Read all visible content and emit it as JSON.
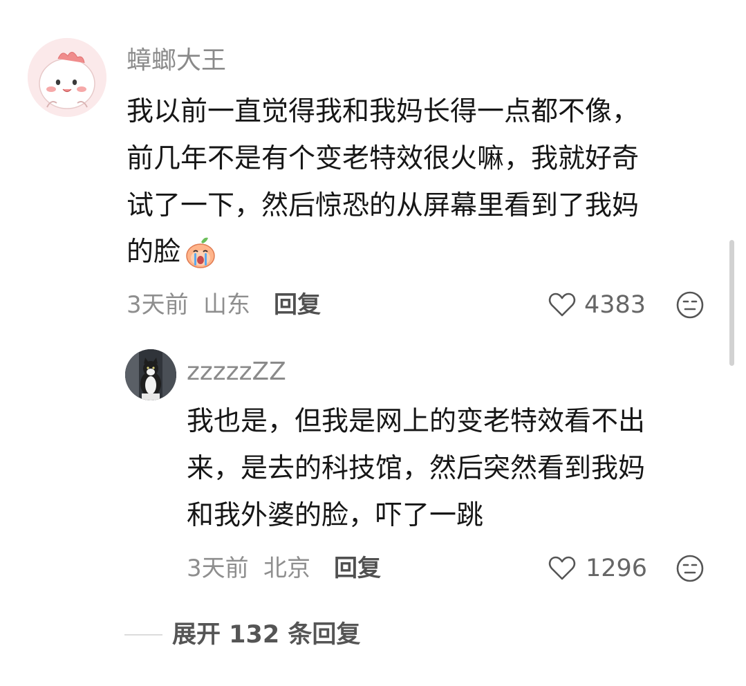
{
  "comment": {
    "username": "蟑螂大王",
    "text_lines": [
      "我以前一直觉得我和我妈长得一点都不像，",
      "前几年不是有个变老特效很火嘛，我就好奇",
      "试了一下，然后惊恐的从屏幕里看到了我妈",
      "的脸"
    ],
    "time": "3天前",
    "location": "山东",
    "reply_label": "回复",
    "likes": "4383",
    "emoji_icon": "crying-peach-emoji",
    "like_icon": "heart-outline-icon",
    "dislike_icon": "unhappy-face-icon"
  },
  "reply": {
    "username": "zzzzzZZ",
    "text_lines": [
      "我也是，但我是网上的变老特效看不出",
      "来，是去的科技馆，然后突然看到我妈",
      "和我外婆的脸，吓了一跳"
    ],
    "time": "3天前",
    "location": "北京",
    "reply_label": "回复",
    "likes": "1296"
  },
  "expand": {
    "label": "展开 132 条回复"
  },
  "colors": {
    "username": "#8a8a8a",
    "text": "#161616",
    "meta": "#8e8e8e"
  }
}
